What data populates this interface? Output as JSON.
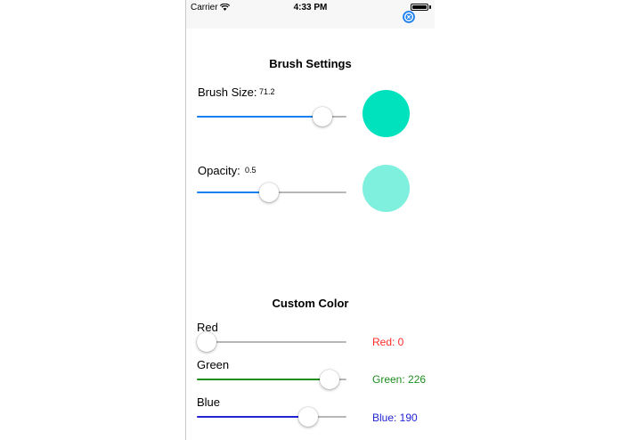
{
  "status_bar": {
    "carrier": "Carrier",
    "time": "4:33 PM"
  },
  "close_icon": "close-circle-icon",
  "brush": {
    "title": "Brush Settings",
    "size_label": "Brush Size:",
    "size_value": "71.2",
    "size_slider_fraction": 0.84,
    "opacity_label": "Opacity:",
    "opacity_value": "0.5",
    "opacity_slider_fraction": 0.48,
    "preview_color": "#00E2BE",
    "preview_opacity_color": "#80F0DE"
  },
  "custom_color": {
    "title": "Custom Color",
    "red": {
      "label": "Red",
      "value_text": "Red: 0",
      "fraction": 0.0,
      "color": "#FF2A2A"
    },
    "green": {
      "label": "Green",
      "value_text": "Green: 226",
      "fraction": 0.886,
      "color": "#1E8E1E"
    },
    "blue": {
      "label": "Blue",
      "value_text": "Blue: 190",
      "fraction": 0.745,
      "color": "#2323D6"
    }
  },
  "accent_color": "#1A7FF0"
}
